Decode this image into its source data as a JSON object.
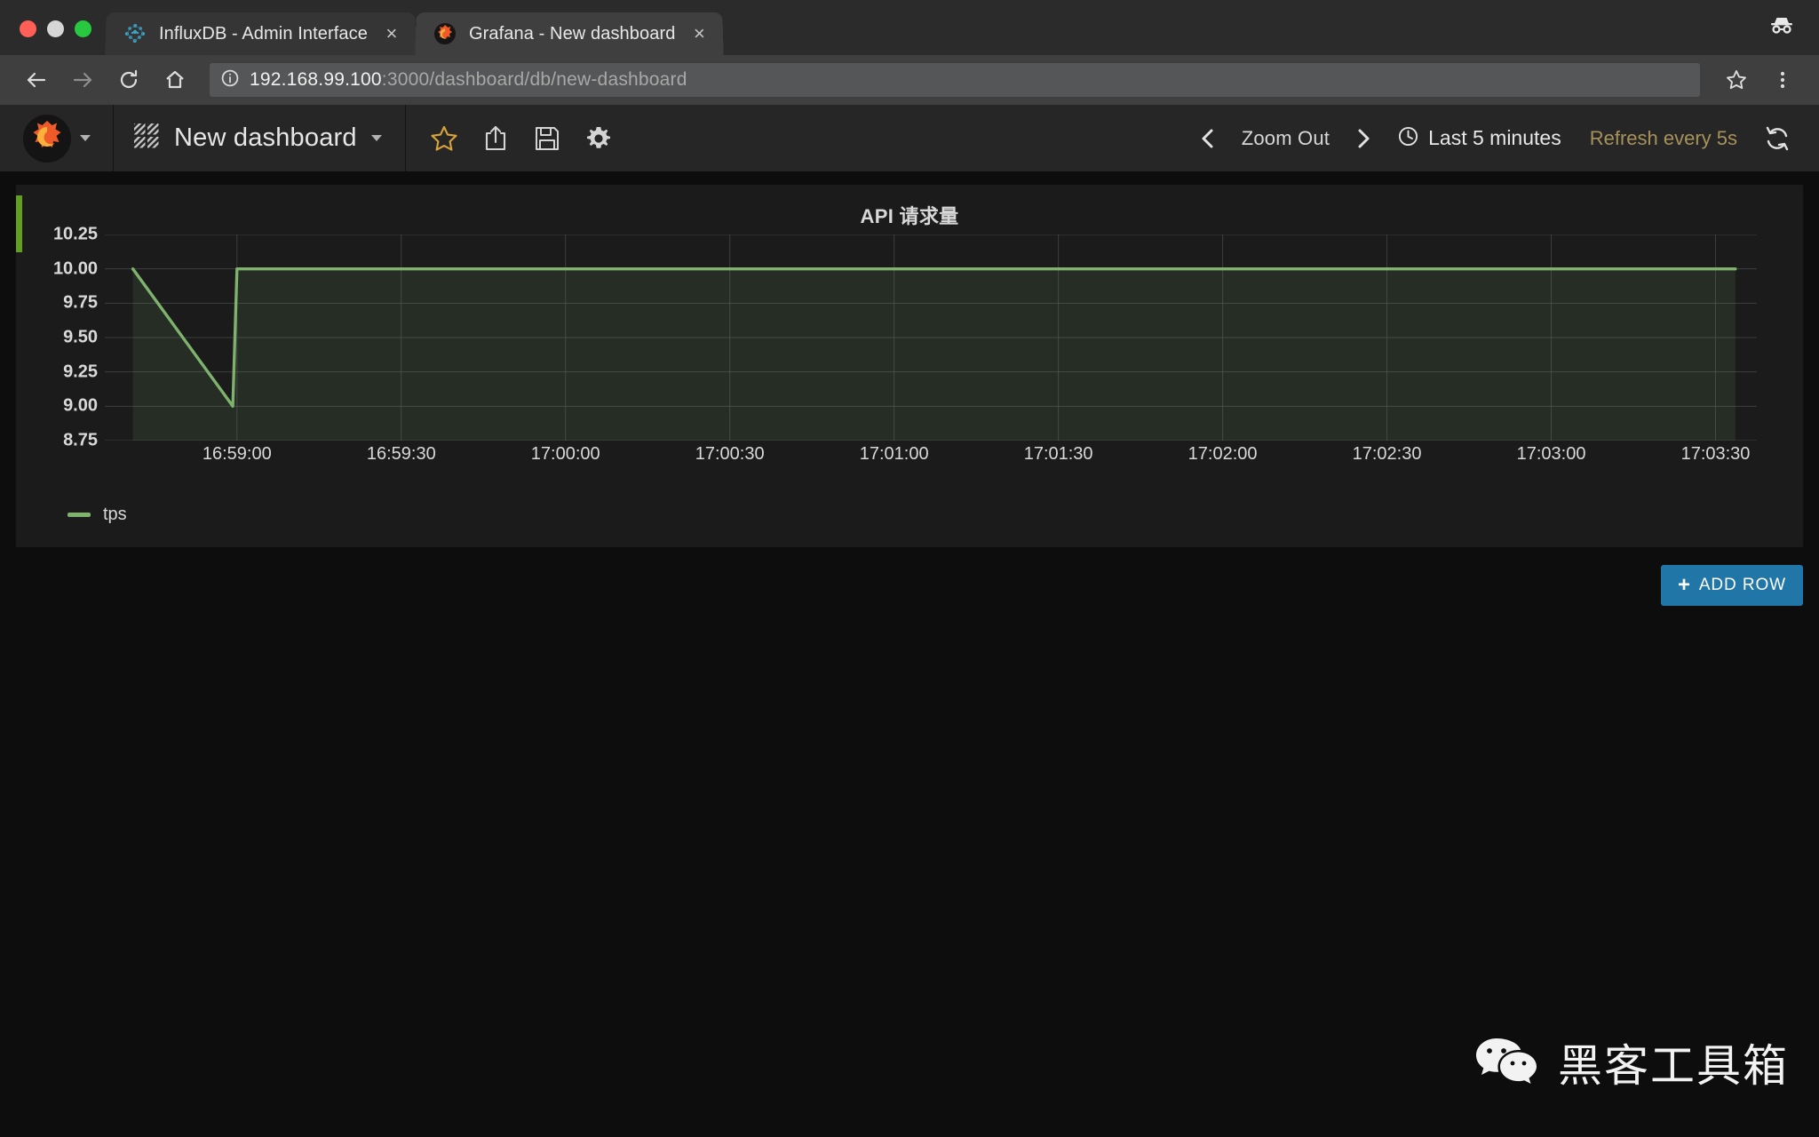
{
  "browser": {
    "tabs": [
      {
        "title": "InfluxDB - Admin Interface",
        "favicon": "influxdb-icon",
        "close_label": "×",
        "active": false
      },
      {
        "title": "Grafana - New dashboard",
        "favicon": "grafana-icon",
        "close_label": "×",
        "active": true
      }
    ],
    "nav": {
      "back_icon": "back-arrow-icon",
      "forward_icon": "forward-arrow-icon",
      "reload_icon": "reload-icon",
      "home_icon": "home-icon"
    },
    "url": {
      "info_icon": "info-circle-icon",
      "host": "192.168.99.100",
      "rest": ":3000/dashboard/db/new-dashboard",
      "full": "192.168.99.100:3000/dashboard/db/new-dashboard"
    },
    "bookmark_icon": "star-outline-icon",
    "menu_icon": "three-dot-menu-icon",
    "incognito_icon": "incognito-icon"
  },
  "grafana": {
    "brand_icon": "grafana-logo-icon",
    "dashboard_icon": "dashboard-grid-icon",
    "dashboard_name": "New dashboard",
    "actions": [
      {
        "name": "star-dashboard-button",
        "icon": "star-icon"
      },
      {
        "name": "share-dashboard-button",
        "icon": "share-icon"
      },
      {
        "name": "save-dashboard-button",
        "icon": "save-floppy-icon"
      },
      {
        "name": "dashboard-settings-button",
        "icon": "gear-icon"
      }
    ],
    "timecontrols": {
      "prev_icon": "chevron-left-icon",
      "zoom_out_label": "Zoom Out",
      "next_icon": "chevron-right-icon",
      "clock_icon": "clock-icon",
      "range_label": "Last 5 minutes",
      "refresh_label": "Refresh every 5s",
      "reload_icon": "refresh-cycle-icon"
    },
    "add_row_label": "ADD ROW",
    "add_row_plus": "+",
    "accent_blue": "#2176a8",
    "alert_green": "#629e22"
  },
  "chart_data": {
    "type": "line",
    "title": "API 请求量",
    "xlabel": "",
    "ylabel": "",
    "grid": true,
    "legend_position": "bottom-left",
    "line_color": "#7eb26d",
    "fill_color": "rgba(126,178,109,0.12)",
    "ylim": [
      8.75,
      10.25
    ],
    "yticks": [
      "8.75",
      "9.00",
      "9.25",
      "9.50",
      "9.75",
      "10.00",
      "10.25"
    ],
    "xticks": [
      "16:59:00",
      "16:59:30",
      "17:00:00",
      "17:00:30",
      "17:01:00",
      "17:01:30",
      "17:02:00",
      "17:02:30",
      "17:03:00",
      "17:03:30"
    ],
    "series": [
      {
        "name": "tps",
        "color": "#7eb26d",
        "x": [
          "16:58:10",
          "16:58:35",
          "16:59:00",
          "16:59:30",
          "17:00:00",
          "17:00:30",
          "17:01:00",
          "17:01:30",
          "17:02:00",
          "17:02:30",
          "17:03:00",
          "17:03:30"
        ],
        "values": [
          10.0,
          9.0,
          10.0,
          10.0,
          10.0,
          10.0,
          10.0,
          10.0,
          10.0,
          10.0,
          10.0,
          10.0
        ]
      }
    ]
  },
  "watermark": {
    "icon": "wechat-icon",
    "text": "黑客工具箱"
  }
}
